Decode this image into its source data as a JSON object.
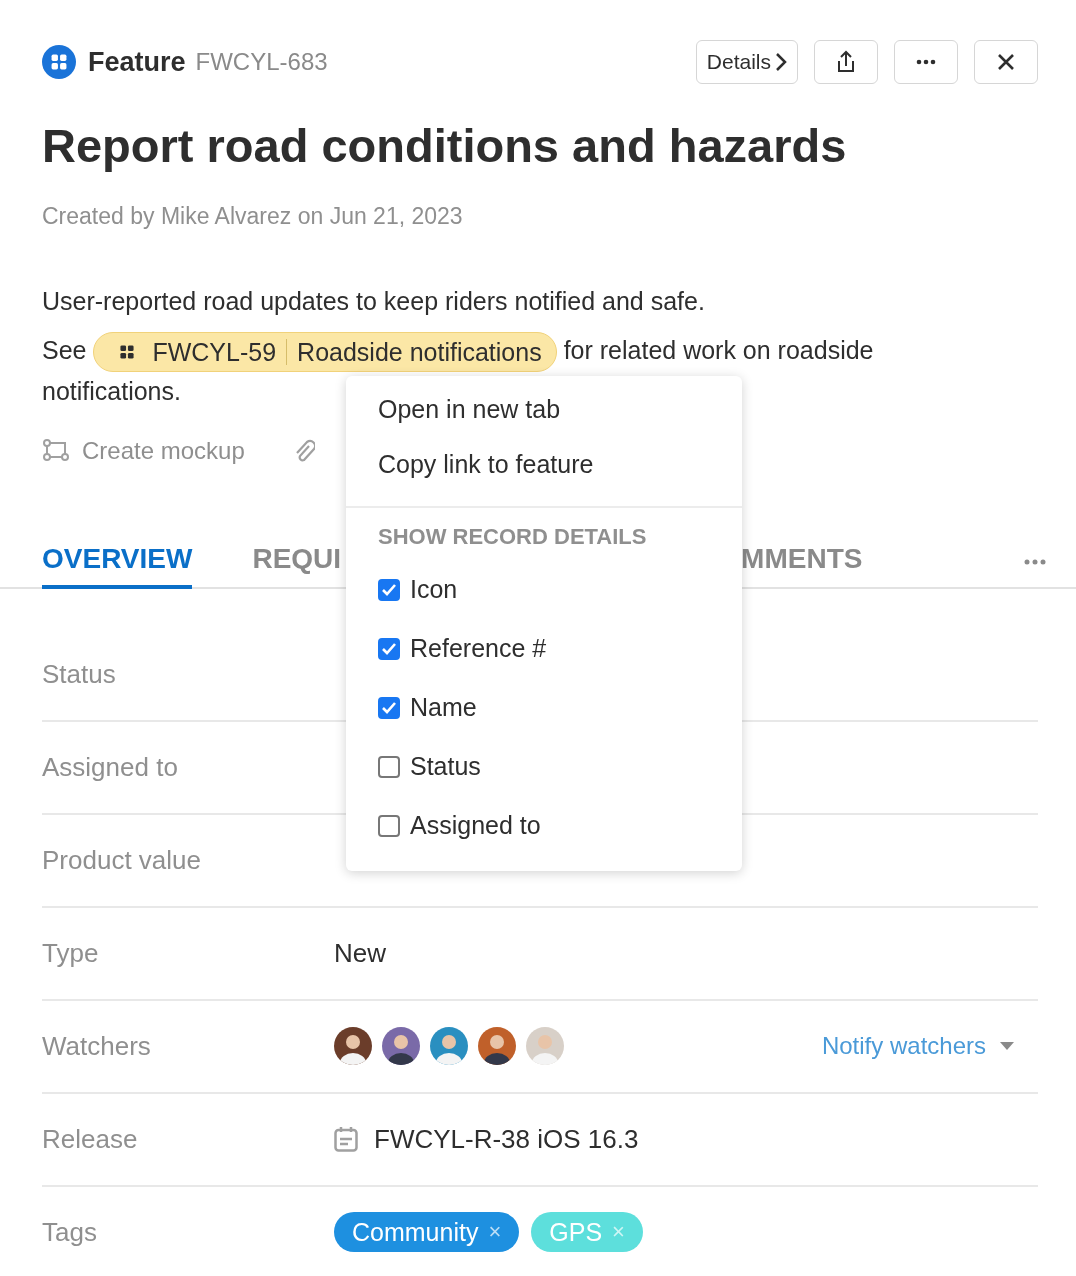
{
  "header": {
    "type": "Feature",
    "reference": "FWCYL-683",
    "buttons": [
      {
        "kind": "details",
        "label": "Details"
      },
      {
        "kind": "share"
      },
      {
        "kind": "more"
      },
      {
        "kind": "close"
      }
    ]
  },
  "title": "Report road conditions and hazards",
  "created": "Created by Mike Alvarez on Jun 21, 2023",
  "description": {
    "line": "User-reported road updates to keep riders notified and safe.",
    "before": "See",
    "chip": {
      "reference": "FWCYL-59",
      "name": "Roadside notifications"
    },
    "after": "for related work on roadside",
    "end": "notifications."
  },
  "actions": [
    {
      "kind": "mockup",
      "label": "Create mockup"
    },
    {
      "kind": "attach"
    }
  ],
  "tabs": [
    {
      "label": "OVERVIEW",
      "selected": true
    },
    {
      "label": "REQUI",
      "selected": false
    },
    {
      "label": "MMENTS",
      "selected": false
    }
  ],
  "fields": [
    {
      "label": "Status",
      "kind": "hidden"
    },
    {
      "label": "Assigned to",
      "kind": "hidden"
    },
    {
      "label": "Product value",
      "kind": "hidden"
    },
    {
      "label": "Type",
      "kind": "text",
      "value": "New"
    },
    {
      "label": "Watchers",
      "kind": "watchers",
      "action": "Notify watchers"
    },
    {
      "label": "Release",
      "kind": "release",
      "value": "FWCYL-R-38 iOS 16.3"
    },
    {
      "label": "Tags",
      "kind": "tags",
      "tags": [
        {
          "label": "Community",
          "remove": "×",
          "color": "#1e90e0"
        },
        {
          "label": "GPS",
          "remove": "×",
          "color": "#5ddfdc"
        }
      ]
    }
  ],
  "menu": {
    "items": [
      "Open in new tab",
      "Copy link to feature"
    ],
    "section": "SHOW RECORD DETAILS",
    "options": [
      {
        "label": "Icon",
        "checked": true
      },
      {
        "label": "Reference #",
        "checked": true
      },
      {
        "label": "Name",
        "checked": true
      },
      {
        "label": "Status",
        "checked": false
      },
      {
        "label": "Assigned to",
        "checked": false
      }
    ]
  }
}
